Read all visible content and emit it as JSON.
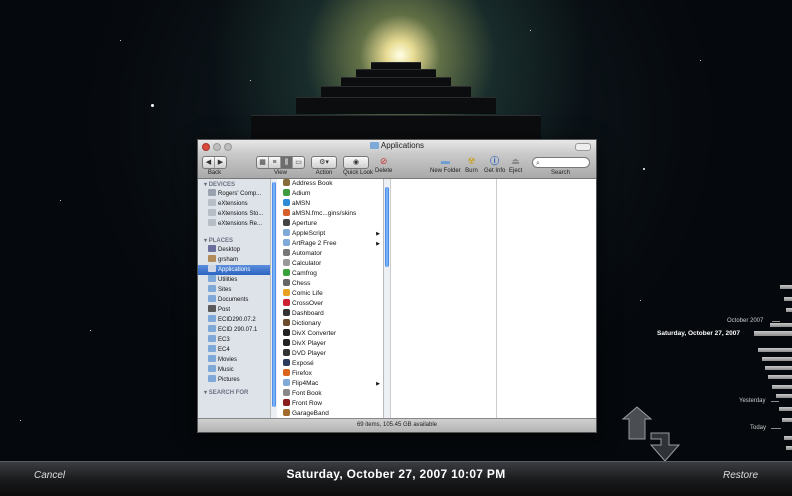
{
  "window": {
    "title": "Applications",
    "toolbar": {
      "back_label": "Back",
      "view_label": "View",
      "action_label": "Action",
      "quicklook_label": "Quick Look",
      "delete_label": "Delete",
      "newfolder_label": "New Folder",
      "burn_label": "Burn",
      "getinfo_label": "Get Info",
      "eject_label": "Eject",
      "search_label": "Search",
      "search_placeholder": ""
    },
    "sidebar": {
      "devices_header": "DEVICES",
      "devices": [
        "Rogers' Comp...",
        "eXtensions",
        "eXtensions Sto...",
        "eXtensions Re..."
      ],
      "places_header": "PLACES",
      "places": [
        "Desktop",
        "grsham",
        "Applications",
        "Utilities",
        "Sites",
        "Documents",
        "Post",
        "ECID290.07.2",
        "ECID 290.07.1",
        "EC3",
        "EC4",
        "Movies",
        "Music",
        "Pictures"
      ],
      "selected": "Applications",
      "search_header": "SEARCH FOR"
    },
    "apps": [
      {
        "name": "Address Book",
        "folder": false
      },
      {
        "name": "Adium",
        "folder": false
      },
      {
        "name": "aMSN",
        "folder": false
      },
      {
        "name": "aMSN.fmc...gins/skins",
        "folder": false
      },
      {
        "name": "Aperture",
        "folder": false
      },
      {
        "name": "AppleScript",
        "folder": true
      },
      {
        "name": "ArtRage 2 Free",
        "folder": true
      },
      {
        "name": "Automator",
        "folder": false
      },
      {
        "name": "Calculator",
        "folder": false
      },
      {
        "name": "Camfrog",
        "folder": false
      },
      {
        "name": "Chess",
        "folder": false
      },
      {
        "name": "Comic Life",
        "folder": false
      },
      {
        "name": "CrossOver",
        "folder": false
      },
      {
        "name": "Dashboard",
        "folder": false
      },
      {
        "name": "Dictionary",
        "folder": false
      },
      {
        "name": "DivX Converter",
        "folder": false
      },
      {
        "name": "DivX Player",
        "folder": false
      },
      {
        "name": "DVD Player",
        "folder": false
      },
      {
        "name": "Exposé",
        "folder": false
      },
      {
        "name": "Firefox",
        "folder": false
      },
      {
        "name": "Flip4Mac",
        "folder": true
      },
      {
        "name": "Font Book",
        "folder": false
      },
      {
        "name": "Front Row",
        "folder": false
      },
      {
        "name": "GarageBand",
        "folder": false
      }
    ],
    "status": "69 items, 105.45 GB available"
  },
  "timeline": {
    "month_label": "October 2007",
    "current_label": "Saturday, October 27, 2007",
    "yesterday_label": "Yesterday",
    "today_label": "Today"
  },
  "bottom_bar": {
    "cancel_label": "Cancel",
    "date_label": "Saturday, October 27, 2007 10:07 PM",
    "restore_label": "Restore"
  },
  "colors": {
    "selection": "#2b64c2",
    "scroll_thumb": "#3b7de0",
    "close_button": "#d94a3a"
  }
}
